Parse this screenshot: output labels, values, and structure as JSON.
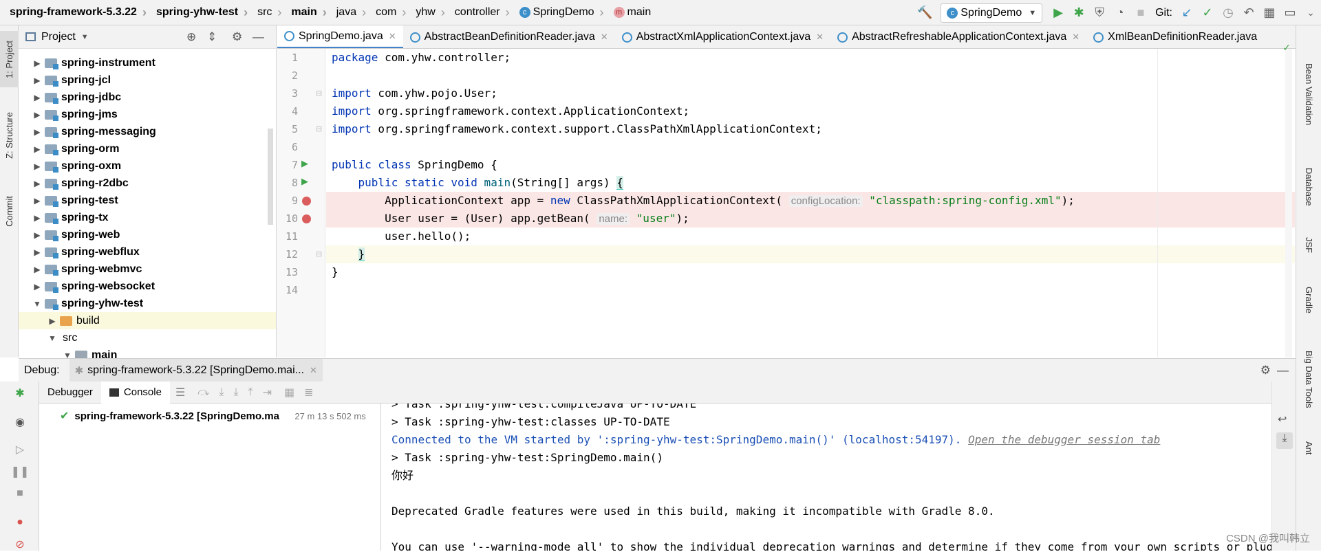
{
  "breadcrumb": [
    "spring-framework-5.3.22",
    "spring-yhw-test",
    "src",
    "main",
    "java",
    "com",
    "yhw",
    "controller",
    "SpringDemo",
    "main"
  ],
  "toolbar": {
    "run_config": "SpringDemo",
    "git_label": "Git:"
  },
  "left_strip": {
    "project": "1: Project",
    "structure": "Z: Structure",
    "commit": "Commit"
  },
  "project_panel": {
    "title": "Project",
    "items": [
      {
        "label": "spring-instrument",
        "type": "module",
        "expanded": false,
        "level": 0
      },
      {
        "label": "spring-jcl",
        "type": "module",
        "expanded": false,
        "level": 0
      },
      {
        "label": "spring-jdbc",
        "type": "module",
        "expanded": false,
        "level": 0
      },
      {
        "label": "spring-jms",
        "type": "module",
        "expanded": false,
        "level": 0
      },
      {
        "label": "spring-messaging",
        "type": "module",
        "expanded": false,
        "level": 0
      },
      {
        "label": "spring-orm",
        "type": "module",
        "expanded": false,
        "level": 0
      },
      {
        "label": "spring-oxm",
        "type": "module",
        "expanded": false,
        "level": 0
      },
      {
        "label": "spring-r2dbc",
        "type": "module",
        "expanded": false,
        "level": 0
      },
      {
        "label": "spring-test",
        "type": "module",
        "expanded": false,
        "level": 0
      },
      {
        "label": "spring-tx",
        "type": "module",
        "expanded": false,
        "level": 0
      },
      {
        "label": "spring-web",
        "type": "module",
        "expanded": false,
        "level": 0
      },
      {
        "label": "spring-webflux",
        "type": "module",
        "expanded": false,
        "level": 0
      },
      {
        "label": "spring-webmvc",
        "type": "module",
        "expanded": false,
        "level": 0
      },
      {
        "label": "spring-websocket",
        "type": "module",
        "expanded": false,
        "level": 0
      },
      {
        "label": "spring-yhw-test",
        "type": "module",
        "expanded": true,
        "level": 0
      },
      {
        "label": "build",
        "type": "folder-orange",
        "expanded": false,
        "level": 1
      },
      {
        "label": "src",
        "type": "none",
        "expanded": true,
        "level": 1
      },
      {
        "label": "main",
        "type": "folder-grey",
        "expanded": true,
        "level": 2
      }
    ]
  },
  "editor_tabs": [
    {
      "label": "SpringDemo.java",
      "active": true
    },
    {
      "label": "AbstractBeanDefinitionReader.java",
      "active": false
    },
    {
      "label": "AbstractXmlApplicationContext.java",
      "active": false
    },
    {
      "label": "AbstractRefreshableApplicationContext.java",
      "active": false
    },
    {
      "label": "XmlBeanDefinitionReader.java",
      "active": false
    }
  ],
  "code": {
    "line_numbers": [
      "1",
      "2",
      "3",
      "4",
      "5",
      "6",
      "7",
      "8",
      "9",
      "10",
      "11",
      "12",
      "13",
      "14"
    ],
    "l1": {
      "kw": "package",
      "rest": " com.yhw.controller;"
    },
    "l3": {
      "kw": "import",
      "rest": " com.yhw.pojo.User;"
    },
    "l4": {
      "kw": "import",
      "rest": " org.springframework.context.ApplicationContext;"
    },
    "l5": {
      "kw": "import",
      "rest": " org.springframework.context.support.ClassPathXmlApplicationContext;"
    },
    "l7": {
      "kw": "public class",
      "rest": " SpringDemo {"
    },
    "l8": {
      "indent": "    ",
      "kw": "public static void",
      "name": " main",
      "rest": "(String[] args) ",
      "brace": "{"
    },
    "l9": {
      "indent": "        ",
      "a": "ApplicationContext app = ",
      "kw": "new",
      "b": " ClassPathXmlApplicationContext(",
      "hint": "configLocation:",
      "str": "\"classpath:spring-config.xml\"",
      "end": ");"
    },
    "l10": {
      "indent": "        ",
      "a": "User user = (User) app.getBean(",
      "hint": "name:",
      "str": "\"user\"",
      "end": ");"
    },
    "l11": {
      "text": "        user.hello();"
    },
    "l12": {
      "indent": "    ",
      "brace": "}"
    },
    "l13": {
      "text": "}"
    }
  },
  "right_strip": [
    "Bean Validation",
    "Database",
    "JSF",
    "Gradle",
    "Big Data Tools",
    "Ant"
  ],
  "debug": {
    "label": "Debug:",
    "session": "spring-framework-5.3.22 [SpringDemo.mai...",
    "tabs": {
      "debugger": "Debugger",
      "console": "Console"
    },
    "frame": {
      "name": "spring-framework-5.3.22 [SpringDemo.ma",
      "time": "27 m 13 s 502 ms"
    },
    "console": {
      "line1": "> Task :spring-yhw-test:compileJava UP-TO-DATE",
      "line2": "> Task :spring-yhw-test:classes UP-TO-DATE",
      "line3": "Connected to the VM started by ':spring-yhw-test:SpringDemo.main()' (localhost:54197). ",
      "line3_link": "Open the debugger session tab",
      "line4": "> Task :spring-yhw-test:SpringDemo.main()",
      "line5": "你好",
      "line6": "",
      "line7": "Deprecated Gradle features were used in this build, making it incompatible with Gradle 8.0.",
      "line8": "",
      "line9": "You can use '--warning-mode all' to show the individual deprecation warnings and determine if they come from your own scripts or plugins."
    }
  },
  "watermark": "CSDN @我叫韩立"
}
